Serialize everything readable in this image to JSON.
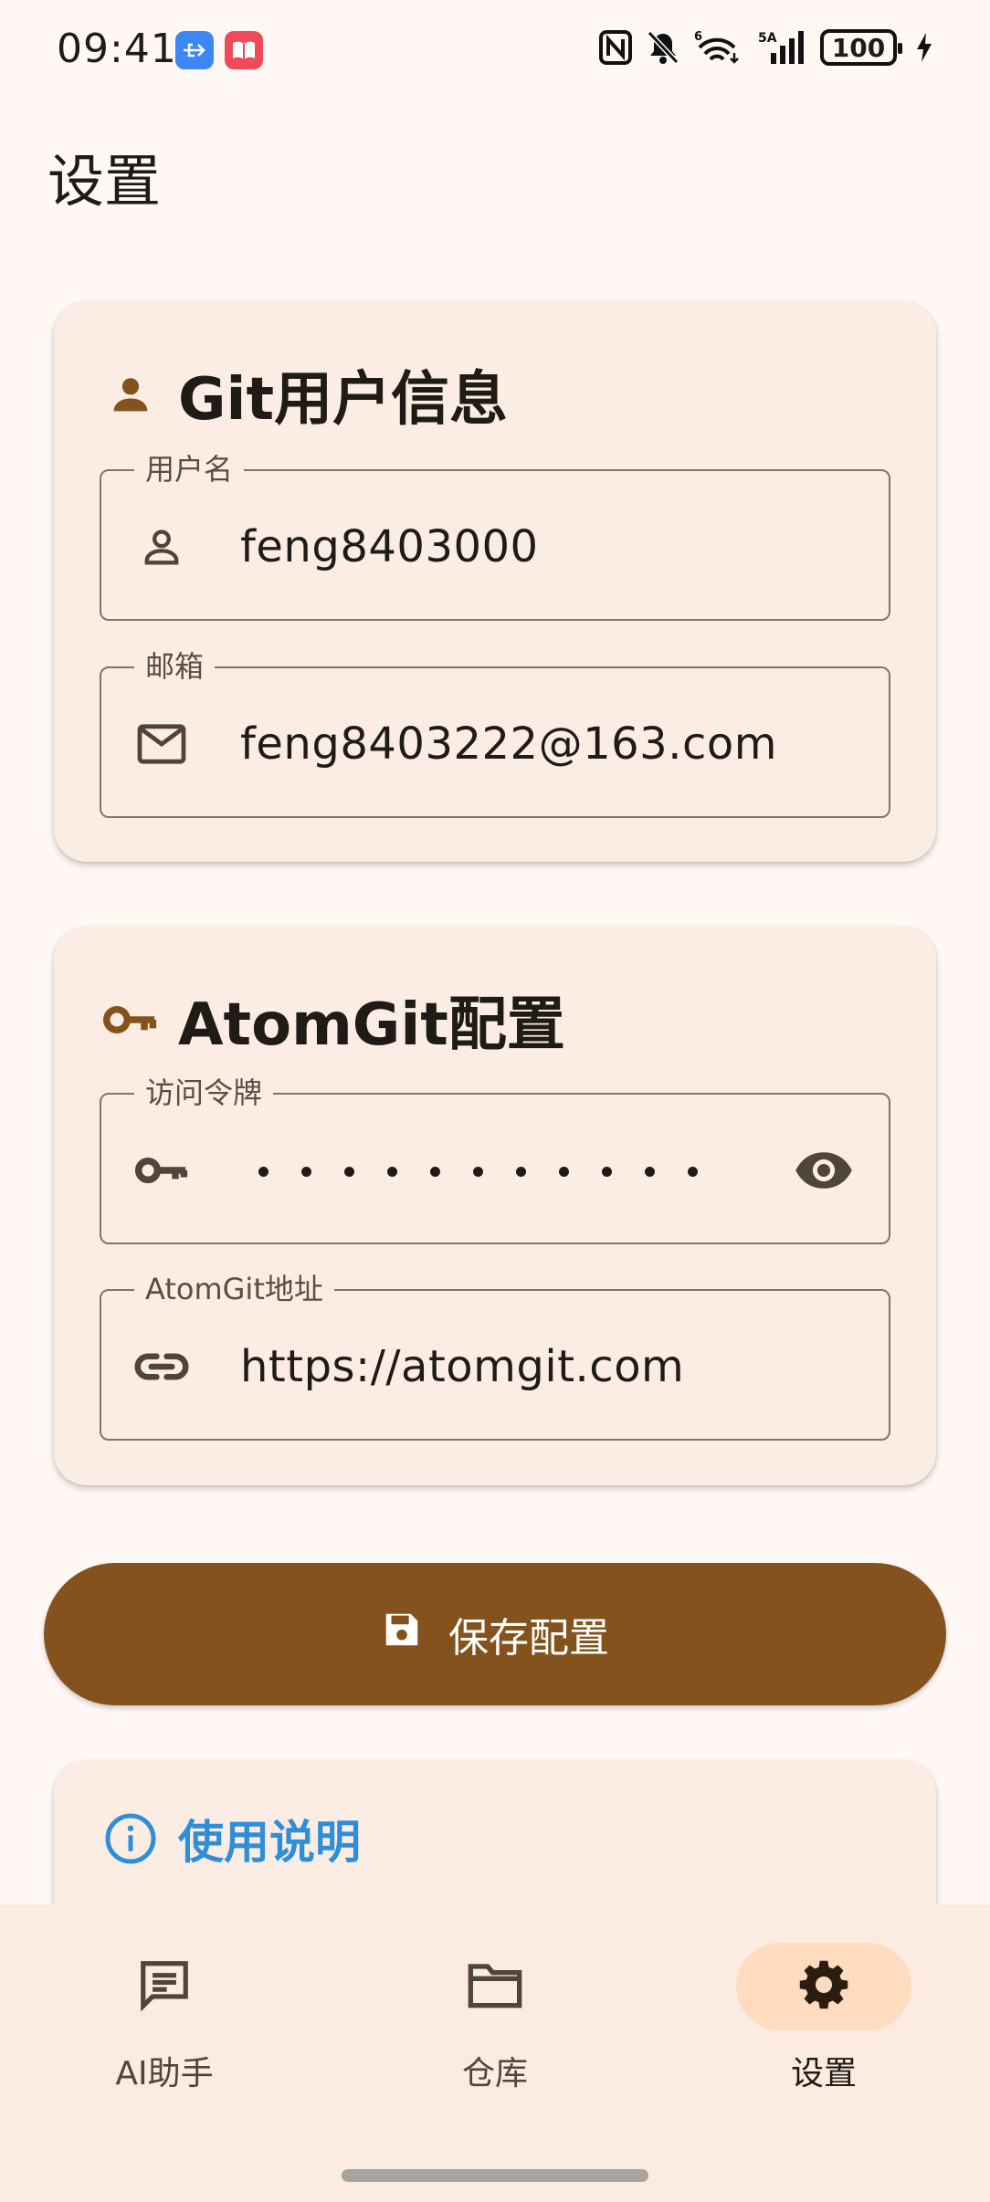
{
  "status_bar": {
    "time": "09:41",
    "icons": [
      "usb-app-icon",
      "book-app-icon",
      "nfc-icon",
      "bell-off-icon",
      "wifi-6-icon",
      "signal-5a-icon"
    ],
    "battery": "100",
    "signal_label": "5A",
    "wifi_label": "6"
  },
  "page": {
    "title": "设置"
  },
  "git_user_card": {
    "title": "Git用户信息",
    "icon": "person-icon",
    "username": {
      "label": "用户名",
      "value": "feng8403000",
      "icon": "person-outline-icon"
    },
    "email": {
      "label": "邮箱",
      "value": "feng8403222@163.com",
      "icon": "mail-icon"
    }
  },
  "atomgit_card": {
    "title": "AtomGit配置",
    "icon": "key-icon",
    "token": {
      "label": "访问令牌",
      "masked_length": 11,
      "icon": "key-icon",
      "trailing_icon": "eye-icon"
    },
    "url": {
      "label": "AtomGit地址",
      "value": "https://atomgit.com",
      "icon": "link-icon"
    }
  },
  "save_button": {
    "label": "保存配置",
    "icon": "save-icon"
  },
  "help_card": {
    "title": "使用说明",
    "icon": "info-icon"
  },
  "bottom_nav": {
    "items": [
      {
        "label": "AI助手",
        "icon": "chat-icon",
        "active": false
      },
      {
        "label": "仓库",
        "icon": "folder-icon",
        "active": false
      },
      {
        "label": "设置",
        "icon": "gear-icon",
        "active": true
      }
    ]
  },
  "colors": {
    "background": "#FFF8F4",
    "card": "#FCEDE4",
    "primary": "#84531D",
    "nav_active": "#FFDCC0",
    "info_blue": "#2E8FD8"
  }
}
